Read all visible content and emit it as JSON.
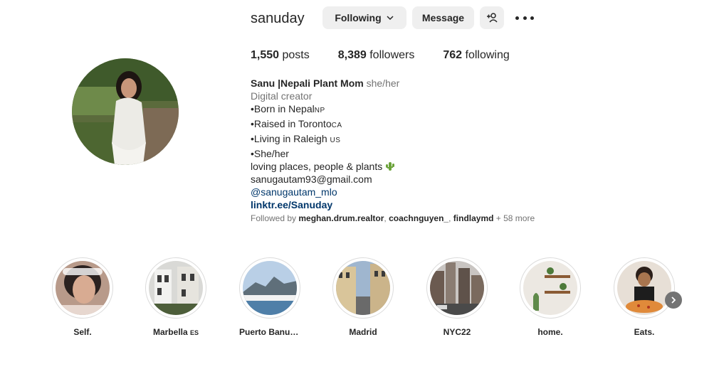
{
  "profile": {
    "username": "sanuday",
    "buttons": {
      "following": "Following",
      "message": "Message"
    }
  },
  "stats": {
    "posts_count": "1,550",
    "posts_label": " posts",
    "followers_count": "8,389",
    "followers_label": " followers",
    "following_count": "762",
    "following_label": " following"
  },
  "bio": {
    "name": "Sanu |Nepali Plant Mom",
    "pronouns": "she/her",
    "category": "Digital creator",
    "line1": "•Born in Nepal",
    "line1_flag": "NP",
    "line2": "•Raised in Toronto",
    "line2_flag": "CA",
    "line3": "•Living in Raleigh",
    "line3_flag": "US",
    "line4": "•She/her",
    "line5": "loving places, people & plants",
    "email": "sanugautam93@gmail.com",
    "mention": "@sanugautam_mlo",
    "link": "linktr.ee/Sanuday"
  },
  "followed_by": {
    "prefix": "Followed by ",
    "user1": "meghan.drum.realtor",
    "sep1": ", ",
    "user2": "coachnguyen_",
    "sep2": ", ",
    "user3": "findlaymd",
    "suffix": " + 58 more"
  },
  "highlights": [
    {
      "label": "Self."
    },
    {
      "label": "Marbella",
      "flag": "ES"
    },
    {
      "label": "Puerto Banus…"
    },
    {
      "label": "Madrid"
    },
    {
      "label": "NYC22"
    },
    {
      "label": "home."
    },
    {
      "label": "Eats."
    }
  ],
  "icons": {
    "following_chevron": "chevron-down-icon",
    "add_user": "add-user-icon",
    "more": "more-options-icon",
    "next": "chevron-right-icon",
    "plant": "cactus-icon"
  },
  "colors": {
    "button_bg": "#efefef",
    "link": "#00376b",
    "muted": "#737373",
    "text": "#262626"
  }
}
